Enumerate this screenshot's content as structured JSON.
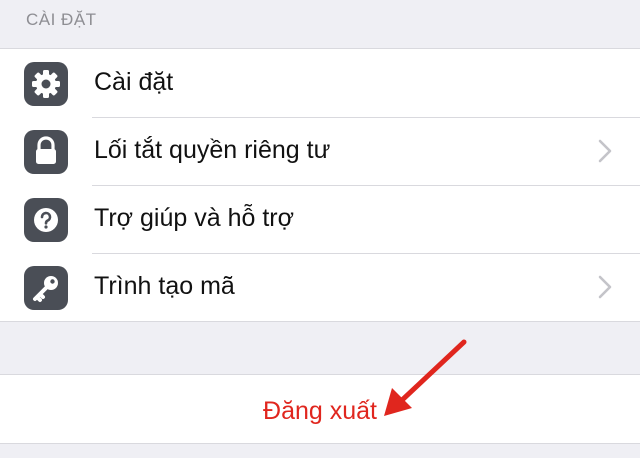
{
  "section": {
    "header": "CÀI ĐẶT"
  },
  "items": [
    {
      "label": "Cài đặt",
      "icon": "gear-icon",
      "has_chevron": false
    },
    {
      "label": "Lối tắt quyền riêng tư",
      "icon": "lock-icon",
      "has_chevron": true
    },
    {
      "label": "Trợ giúp và hỗ trợ",
      "icon": "question-icon",
      "has_chevron": false
    },
    {
      "label": "Trình tạo mã",
      "icon": "key-icon",
      "has_chevron": true
    }
  ],
  "logout": {
    "label": "Đăng xuất",
    "color": "#e0261e"
  },
  "colors": {
    "background": "#efeff4",
    "icon_tile": "#4a4e56",
    "separator": "#d9d9de",
    "annotation_arrow": "#e0261e"
  }
}
